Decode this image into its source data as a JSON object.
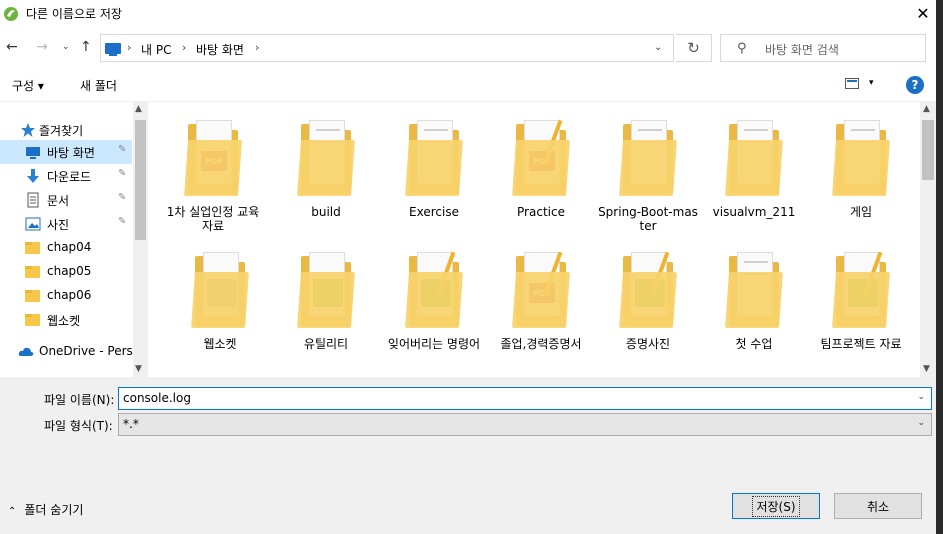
{
  "window": {
    "title": "다른 이름으로 저장",
    "close_glyph": "✕"
  },
  "nav": {
    "back": "←",
    "forward": "→",
    "recent": "⌄",
    "up": "↑",
    "address": [
      "내 PC",
      "바탕 화면"
    ],
    "address_dropdown": "⌄",
    "refresh": "↻",
    "search_placeholder": "바탕 화면 검색"
  },
  "toolbar": {
    "organize": "구성 ▾",
    "new_folder": "새 폴더",
    "view_dd": "▾",
    "help": "?"
  },
  "sidebar": {
    "items": [
      {
        "label": "즐겨찾기",
        "icon": "star-icon"
      },
      {
        "label": "바탕 화면",
        "icon": "desktop-icon",
        "selected": true,
        "pinned": true
      },
      {
        "label": "다운로드",
        "icon": "download-icon",
        "pinned": true
      },
      {
        "label": "문서",
        "icon": "document-icon",
        "pinned": true
      },
      {
        "label": "사진",
        "icon": "picture-icon",
        "pinned": true
      },
      {
        "label": "chap04",
        "icon": "folder-icon"
      },
      {
        "label": "chap05",
        "icon": "folder-icon"
      },
      {
        "label": "chap06",
        "icon": "folder-icon"
      },
      {
        "label": "웹소켓",
        "icon": "folder-icon"
      },
      {
        "label": "OneDrive - Perso",
        "icon": "cloud-icon"
      }
    ],
    "pin_glyph": "📌"
  },
  "files": [
    {
      "label": "1차 실업인정 교육자료",
      "kind": "pdf"
    },
    {
      "label": "build",
      "kind": "doc"
    },
    {
      "label": "Exercise",
      "kind": "doc"
    },
    {
      "label": "Practice",
      "kind": "pdf"
    },
    {
      "label": "Spring-Boot-master",
      "kind": "doc"
    },
    {
      "label": "visualvm_211",
      "kind": "doc"
    },
    {
      "label": "게임",
      "kind": "doc"
    },
    {
      "label": "웹소켓",
      "kind": "img"
    },
    {
      "label": "유틸리티",
      "kind": "img"
    },
    {
      "label": "잊어버리는 명령어",
      "kind": "img"
    },
    {
      "label": "졸업,경력증명서",
      "kind": "pdf"
    },
    {
      "label": "증명사진",
      "kind": "img"
    },
    {
      "label": "첫 수업",
      "kind": "doc"
    },
    {
      "label": "팀프로젝트 자료",
      "kind": "img"
    }
  ],
  "form": {
    "filename_label": "파일 이름(N):",
    "filename_value": "console.log",
    "filetype_label": "파일 형식(T):",
    "filetype_value": "*.*",
    "hide_folders": "폴더 숨기기",
    "save": "저장(S)",
    "cancel": "취소"
  },
  "colors": {
    "accent": "#0078d7",
    "selected": "#cce8ff",
    "folder": "#f8d36a"
  }
}
